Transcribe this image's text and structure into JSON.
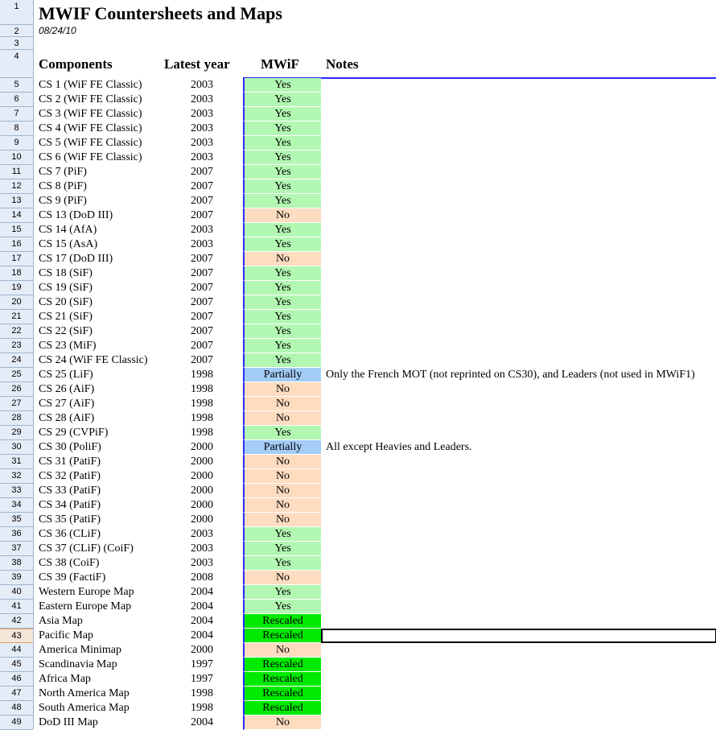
{
  "title": "MWIF Countersheets and Maps",
  "date": "08/24/10",
  "headers": {
    "components": "Components",
    "year": "Latest year",
    "mwif": "MWiF",
    "notes": "Notes"
  },
  "row_numbers": [
    "1",
    "2",
    "3",
    "4"
  ],
  "status_colors": {
    "Yes": "#b2f7b2",
    "No": "#fddcc0",
    "Partially": "#a3cdf7",
    "Rescaled": "#00ea00"
  },
  "selected_row": "43",
  "rows": [
    {
      "n": "5",
      "name": "CS 1 (WiF FE Classic)",
      "year": "2003",
      "status": "Yes",
      "note": ""
    },
    {
      "n": "6",
      "name": "CS 2 (WiF FE Classic)",
      "year": "2003",
      "status": "Yes",
      "note": ""
    },
    {
      "n": "7",
      "name": "CS 3 (WiF FE Classic)",
      "year": "2003",
      "status": "Yes",
      "note": ""
    },
    {
      "n": "8",
      "name": "CS 4 (WiF FE Classic)",
      "year": "2003",
      "status": "Yes",
      "note": ""
    },
    {
      "n": "9",
      "name": "CS 5 (WiF FE Classic)",
      "year": "2003",
      "status": "Yes",
      "note": ""
    },
    {
      "n": "10",
      "name": "CS 6 (WiF FE Classic)",
      "year": "2003",
      "status": "Yes",
      "note": ""
    },
    {
      "n": "11",
      "name": "CS 7 (PiF)",
      "year": "2007",
      "status": "Yes",
      "note": ""
    },
    {
      "n": "12",
      "name": "CS 8 (PiF)",
      "year": "2007",
      "status": "Yes",
      "note": ""
    },
    {
      "n": "13",
      "name": "CS 9 (PiF)",
      "year": "2007",
      "status": "Yes",
      "note": ""
    },
    {
      "n": "14",
      "name": "CS 13 (DoD III)",
      "year": "2007",
      "status": "No",
      "note": ""
    },
    {
      "n": "15",
      "name": "CS 14 (AfA)",
      "year": "2003",
      "status": "Yes",
      "note": ""
    },
    {
      "n": "16",
      "name": "CS 15 (AsA)",
      "year": "2003",
      "status": "Yes",
      "note": ""
    },
    {
      "n": "17",
      "name": "CS 17 (DoD III)",
      "year": "2007",
      "status": "No",
      "note": ""
    },
    {
      "n": "18",
      "name": "CS 18 (SiF)",
      "year": "2007",
      "status": "Yes",
      "note": ""
    },
    {
      "n": "19",
      "name": "CS 19 (SiF)",
      "year": "2007",
      "status": "Yes",
      "note": ""
    },
    {
      "n": "20",
      "name": "CS 20 (SiF)",
      "year": "2007",
      "status": "Yes",
      "note": ""
    },
    {
      "n": "21",
      "name": "CS 21 (SiF)",
      "year": "2007",
      "status": "Yes",
      "note": ""
    },
    {
      "n": "22",
      "name": "CS 22 (SiF)",
      "year": "2007",
      "status": "Yes",
      "note": ""
    },
    {
      "n": "23",
      "name": "CS 23 (MiF)",
      "year": "2007",
      "status": "Yes",
      "note": ""
    },
    {
      "n": "24",
      "name": "CS 24 (WiF FE Classic)",
      "year": "2007",
      "status": "Yes",
      "note": ""
    },
    {
      "n": "25",
      "name": "CS 25 (LiF)",
      "year": "1998",
      "status": "Partially",
      "note": "Only the French MOT (not reprinted on CS30), and Leaders (not used in MWiF1)"
    },
    {
      "n": "26",
      "name": "CS 26 (AiF)",
      "year": "1998",
      "status": "No",
      "note": ""
    },
    {
      "n": "27",
      "name": "CS 27 (AiF)",
      "year": "1998",
      "status": "No",
      "note": ""
    },
    {
      "n": "28",
      "name": "CS 28 (AiF)",
      "year": "1998",
      "status": "No",
      "note": ""
    },
    {
      "n": "29",
      "name": "CS 29 (CVPiF)",
      "year": "1998",
      "status": "Yes",
      "note": ""
    },
    {
      "n": "30",
      "name": "CS 30 (PoliF)",
      "year": "2000",
      "status": "Partially",
      "note": "All except Heavies and Leaders."
    },
    {
      "n": "31",
      "name": "CS 31 (PatiF)",
      "year": "2000",
      "status": "No",
      "note": ""
    },
    {
      "n": "32",
      "name": "CS 32 (PatiF)",
      "year": "2000",
      "status": "No",
      "note": ""
    },
    {
      "n": "33",
      "name": "CS 33 (PatiF)",
      "year": "2000",
      "status": "No",
      "note": ""
    },
    {
      "n": "34",
      "name": "CS 34 (PatiF)",
      "year": "2000",
      "status": "No",
      "note": ""
    },
    {
      "n": "35",
      "name": "CS 35 (PatiF)",
      "year": "2000",
      "status": "No",
      "note": ""
    },
    {
      "n": "36",
      "name": "CS 36 (CLiF)",
      "year": "2003",
      "status": "Yes",
      "note": ""
    },
    {
      "n": "37",
      "name": "CS 37 (CLiF) (CoiF)",
      "year": "2003",
      "status": "Yes",
      "note": ""
    },
    {
      "n": "38",
      "name": "CS 38 (CoiF)",
      "year": "2003",
      "status": "Yes",
      "note": ""
    },
    {
      "n": "39",
      "name": "CS 39 (FactiF)",
      "year": "2008",
      "status": "No",
      "note": ""
    },
    {
      "n": "40",
      "name": "Western Europe Map",
      "year": "2004",
      "status": "Yes",
      "note": ""
    },
    {
      "n": "41",
      "name": "Eastern Europe Map",
      "year": "2004",
      "status": "Yes",
      "note": ""
    },
    {
      "n": "42",
      "name": "Asia Map",
      "year": "2004",
      "status": "Rescaled",
      "note": ""
    },
    {
      "n": "43",
      "name": "Pacific Map",
      "year": "2004",
      "status": "Rescaled",
      "note": ""
    },
    {
      "n": "44",
      "name": "America Minimap",
      "year": "2000",
      "status": "No",
      "note": ""
    },
    {
      "n": "45",
      "name": "Scandinavia Map",
      "year": "1997",
      "status": "Rescaled",
      "note": ""
    },
    {
      "n": "46",
      "name": "Africa Map",
      "year": "1997",
      "status": "Rescaled",
      "note": ""
    },
    {
      "n": "47",
      "name": "North America Map",
      "year": "1998",
      "status": "Rescaled",
      "note": ""
    },
    {
      "n": "48",
      "name": "South America Map",
      "year": "1998",
      "status": "Rescaled",
      "note": ""
    },
    {
      "n": "49",
      "name": "DoD III Map",
      "year": "2004",
      "status": "No",
      "note": ""
    }
  ]
}
